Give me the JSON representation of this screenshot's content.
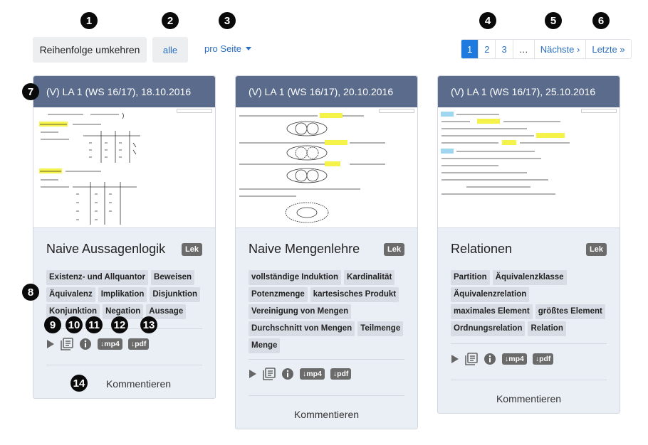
{
  "toolbar": {
    "reverse_label": "Reihenfolge umkehren",
    "all_label": "alle",
    "per_page_label": "pro Seite"
  },
  "pagination": {
    "pages": [
      "1",
      "2",
      "3",
      "…"
    ],
    "next_label": "Nächste ›",
    "last_label": "Letzte »",
    "active_page": "1"
  },
  "callouts": [
    "1",
    "2",
    "3",
    "4",
    "5",
    "6",
    "7",
    "8",
    "9",
    "10",
    "11",
    "12",
    "13",
    "14"
  ],
  "cards": [
    {
      "header": "(V) LA 1 (WS 16/17), 18.10.2016",
      "title": "Naive Aussagenlogik",
      "badge": "Lek",
      "tags": [
        "Existenz- und Allquantor",
        "Beweisen",
        "Äquivalenz",
        "Implikation",
        "Disjunktion",
        "Konjunktion",
        "Negation",
        "Aussage"
      ],
      "dl_mp4": "↓mp4",
      "dl_pdf": "↓pdf",
      "comment": "Kommentieren"
    },
    {
      "header": "(V) LA 1 (WS 16/17), 20.10.2016",
      "title": "Naive Mengenlehre",
      "badge": "Lek",
      "tags": [
        "vollständige Induktion",
        "Kardinalität",
        "Potenzmenge",
        "kartesisches Produkt",
        "Vereinigung von Mengen",
        "Durchschnitt von Mengen",
        "Teilmenge",
        "Menge"
      ],
      "dl_mp4": "↓mp4",
      "dl_pdf": "↓pdf",
      "comment": "Kommentieren"
    },
    {
      "header": "(V) LA 1 (WS 16/17), 25.10.2016",
      "title": "Relationen",
      "badge": "Lek",
      "tags": [
        "Partition",
        "Äquivalenzklasse",
        "Äquivalenzrelation",
        "maximales Element",
        "größtes Element",
        "Ordnungsrelation",
        "Relation"
      ],
      "dl_mp4": "↓mp4",
      "dl_pdf": "↓pdf",
      "comment": "Kommentieren"
    }
  ],
  "colors": {
    "card_header": "#5a6b8c",
    "card_body": "#eaeef5",
    "accent_blue": "#1f7ae0",
    "highlight_yellow": "#f5f34a"
  },
  "icons": [
    "play-icon",
    "transcript-icon",
    "info-icon"
  ]
}
